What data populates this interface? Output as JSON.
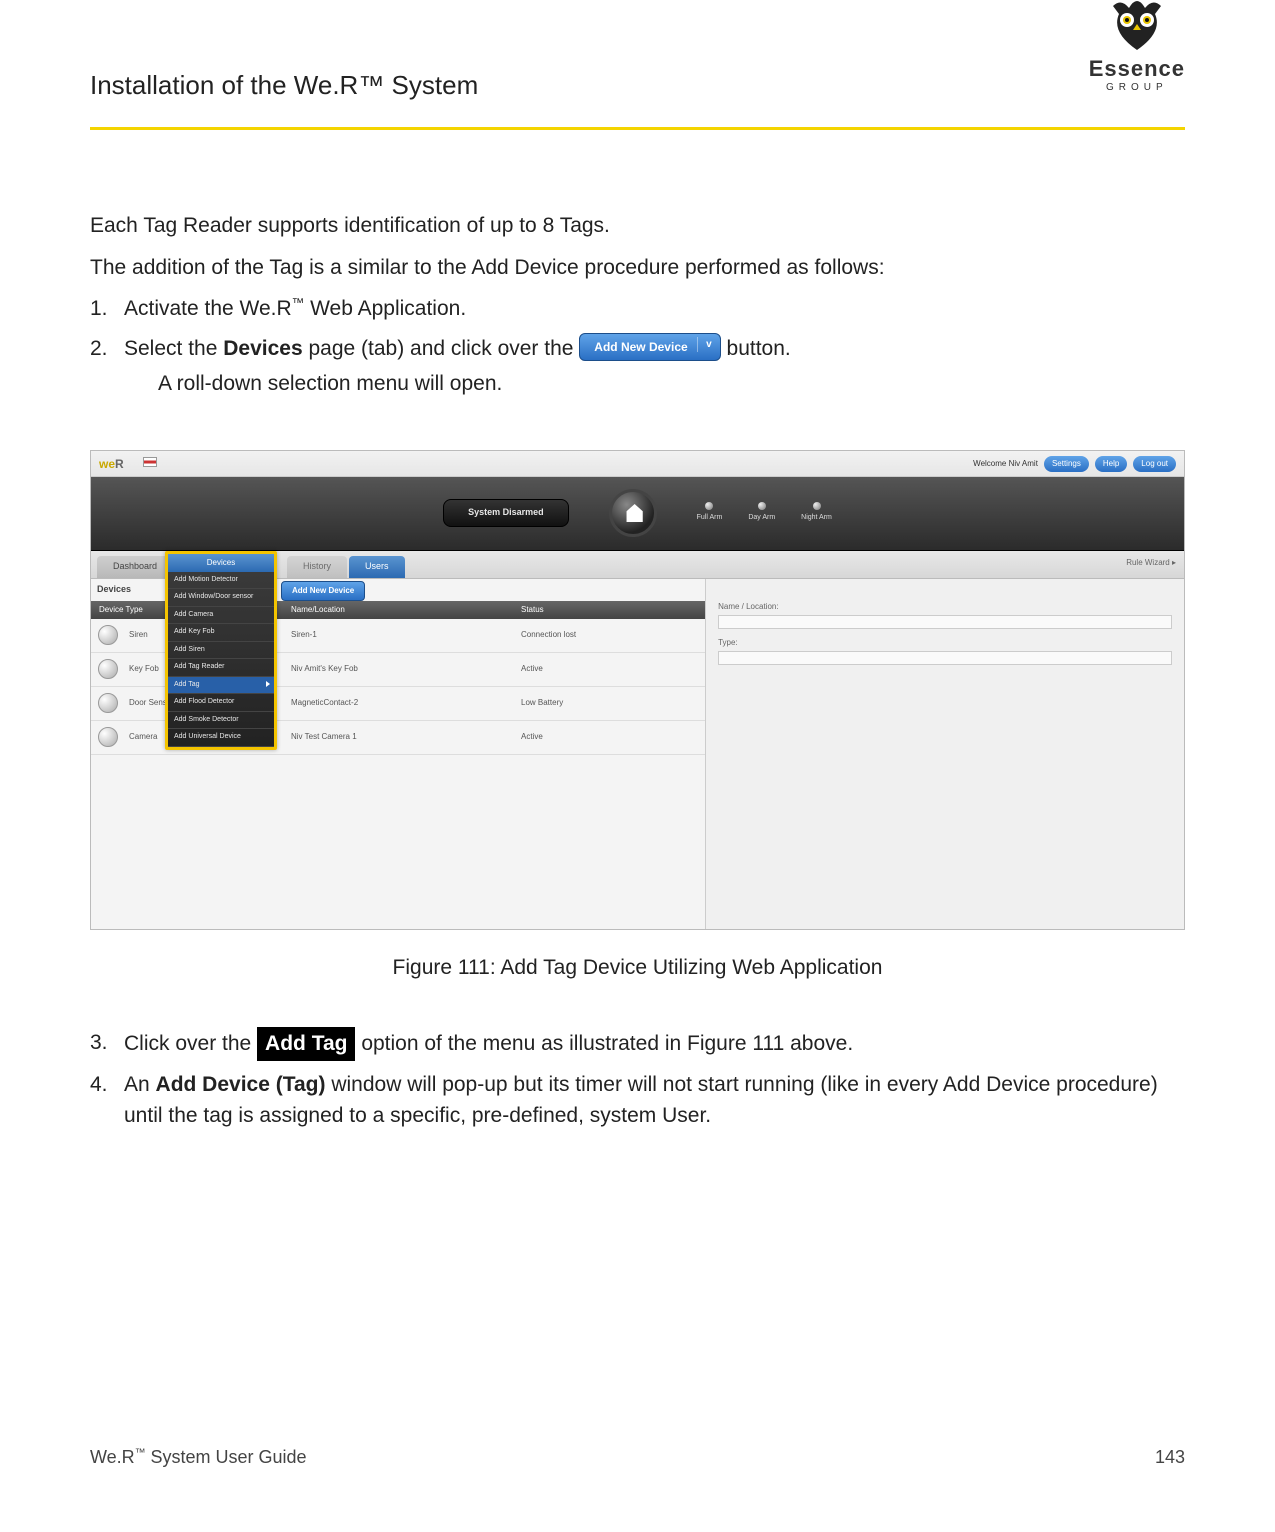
{
  "header": {
    "title": "Installation of the We.R™ System",
    "brand": "Essence",
    "brand_sub": "GROUP"
  },
  "intro": {
    "p1": "Each Tag Reader supports identification of up to 8 Tags.",
    "p2": "The addition of the Tag is a similar to the Add Device procedure performed as follows:"
  },
  "steps": {
    "s1_num": "1.",
    "s1_a": "Activate the We.R",
    "s1_tm": "™",
    "s1_b": " Web Application.",
    "s2_num": "2.",
    "s2_a": "Select the ",
    "s2_devices": "Devices",
    "s2_b": " page (tab) and click over the ",
    "s2_btn": "Add New Device",
    "s2_c": " button.",
    "s2_sub": "A roll-down selection menu will open.",
    "s3_num": "3.",
    "s3_a": "Click over the ",
    "s3_chip": " Add Tag ",
    "s3_b": " option of the menu as illustrated in Figure 111 above.",
    "s4_num": "4.",
    "s4_a": "An ",
    "s4_bold": "Add Device (Tag)",
    "s4_b": " window will pop-up but its timer will not start running (like in every Add Device procedure) until the tag is assigned to a specific, pre-defined, system User."
  },
  "figure": {
    "caption": "Figure 111: Add Tag Device Utilizing Web Application"
  },
  "screenshot": {
    "welcome": "Welcome  Niv Amit",
    "settings": "Settings",
    "help": "Help",
    "logout": "Log out",
    "status": "System Disarmed",
    "arm": {
      "full": "Full Arm",
      "day": "Day Arm",
      "night": "Night Arm"
    },
    "tabs": {
      "dashboard": "Dashboard",
      "devices": "Devices",
      "history": "History",
      "users": "Users"
    },
    "rule_wizard": "Rule Wizard ▸",
    "devices_label": "Devices",
    "add_new_small": "Add New Device",
    "cols": {
      "type": "Device Type",
      "name": "Name/Location",
      "status": "Status"
    },
    "rows": [
      {
        "type": "Siren",
        "name": "Siren-1",
        "status": "Connection lost"
      },
      {
        "type": "Key Fob",
        "name": "Niv Amit's Key Fob",
        "status": "Active"
      },
      {
        "type": "Door Sensor",
        "name": "MagneticContact-2",
        "status": "Low Battery"
      },
      {
        "type": "Camera",
        "name": "Niv Test Camera 1",
        "status": "Active"
      }
    ],
    "dropdown": {
      "tab": "Devices",
      "items": [
        "Add Motion Detector",
        "Add Window/Door sensor",
        "Add Camera",
        "Add Key Fob",
        "Add Siren",
        "Add Tag Reader",
        "Add Tag",
        "Add Flood Detector",
        "Add Smoke Detector",
        "Add Universal Device"
      ],
      "selected_index": 6
    },
    "right": {
      "name_loc": "Name / Location:",
      "type": "Type:"
    }
  },
  "footer": {
    "left_a": "We.R",
    "left_tm": "™",
    "left_b": " System User Guide",
    "right": "143"
  }
}
